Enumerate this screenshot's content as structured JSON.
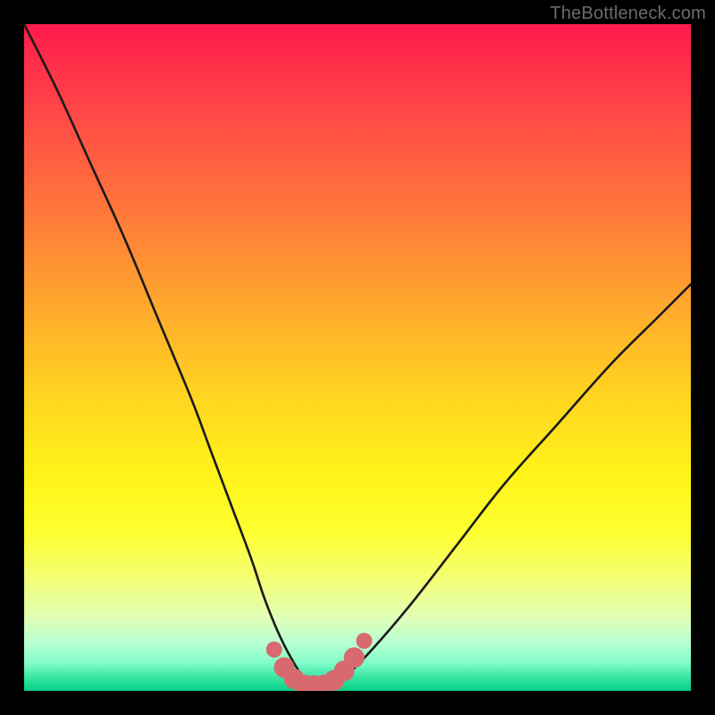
{
  "watermark": {
    "text": "TheBottleneck.com"
  },
  "colors": {
    "background": "#000000",
    "curve": "#1a1a1a",
    "marker": "#d86a6f"
  },
  "chart_data": {
    "type": "line",
    "title": "",
    "xlabel": "",
    "ylabel": "",
    "xlim": [
      0,
      100
    ],
    "ylim": [
      0,
      100
    ],
    "grid": false,
    "series": [
      {
        "name": "bottleneck-curve",
        "x": [
          0,
          5,
          10,
          15,
          20,
          25,
          28,
          31,
          34,
          36,
          38,
          40,
          42,
          44,
          46,
          48,
          52,
          58,
          65,
          72,
          80,
          88,
          95,
          100
        ],
        "values": [
          100,
          90,
          79,
          68,
          56,
          44,
          36,
          28,
          20,
          14,
          9,
          5,
          2,
          1,
          1,
          2,
          6,
          13,
          22,
          31,
          40,
          49,
          56,
          61
        ]
      }
    ],
    "markers": {
      "name": "bottom-highlight",
      "x": [
        37.5,
        39.0,
        40.5,
        42.0,
        43.5,
        45.0,
        46.5,
        48.0,
        49.5,
        51.0
      ],
      "values": [
        6.2,
        3.5,
        1.8,
        0.9,
        0.8,
        0.9,
        1.6,
        3.0,
        5.0,
        7.5
      ]
    }
  }
}
